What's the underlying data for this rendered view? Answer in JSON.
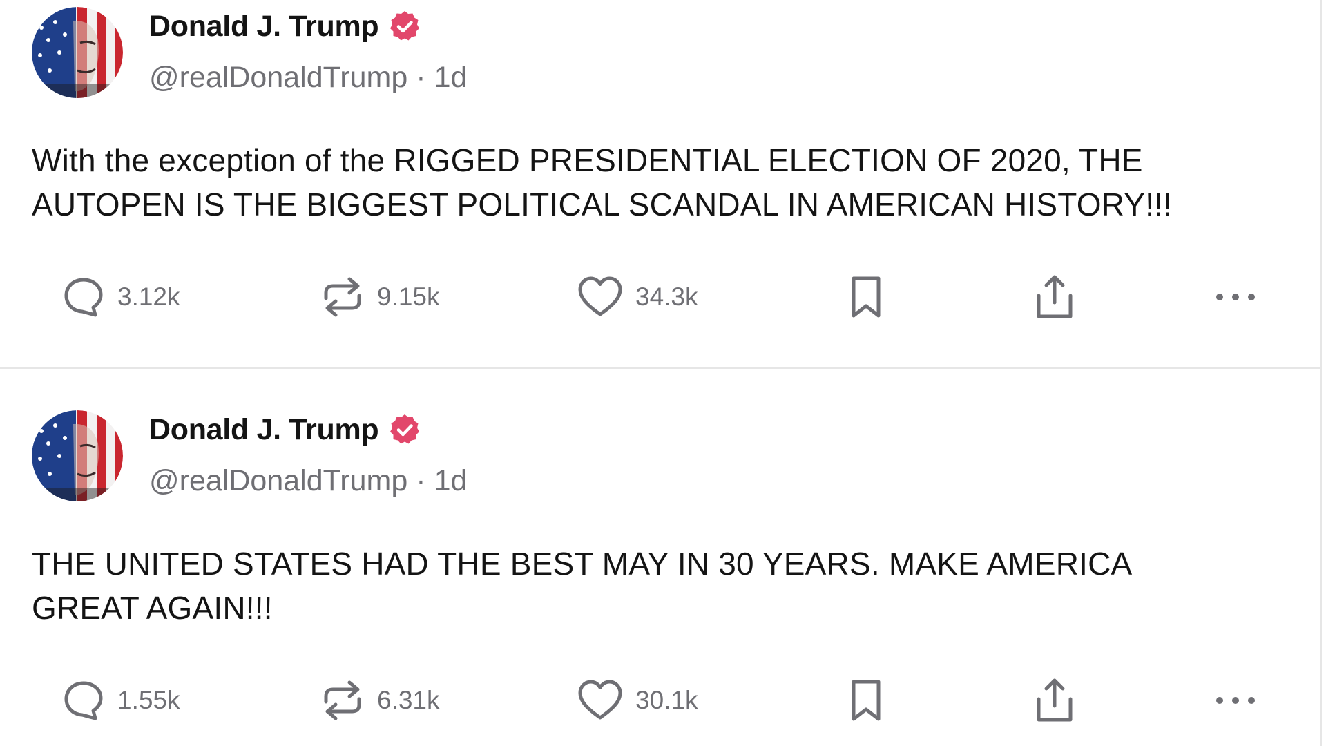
{
  "posts": [
    {
      "author_name": "Donald J. Trump",
      "handle": "@realDonaldTrump",
      "separator": "·",
      "time": "1d",
      "text": "With the exception of the RIGGED PRESIDENTIAL ELECTION OF 2020, THE\nAUTOPEN IS THE BIGGEST POLITICAL SCANDAL IN AMERICAN HISTORY!!!",
      "replies": "3.12k",
      "reposts": "9.15k",
      "likes": "34.3k"
    },
    {
      "author_name": "Donald J. Trump",
      "handle": "@realDonaldTrump",
      "separator": "·",
      "time": "1d",
      "text": "THE UNITED STATES HAD THE BEST MAY IN 30 YEARS. MAKE AMERICA\nGREAT AGAIN!!!",
      "replies": "1.55k",
      "reposts": "6.31k",
      "likes": "30.1k"
    }
  ],
  "icons": {
    "avatar": "avatar-flag-face",
    "verified": "verified-badge-icon",
    "reply": "reply-bubble-icon",
    "repost": "repost-icon",
    "like": "heart-icon",
    "bookmark": "bookmark-icon",
    "share": "share-icon",
    "more": "more-dots-icon"
  },
  "colors": {
    "verified_badge": "#e2476b",
    "text_primary": "#141414",
    "text_secondary": "#6f6f74",
    "divider": "#e6e6e6"
  }
}
